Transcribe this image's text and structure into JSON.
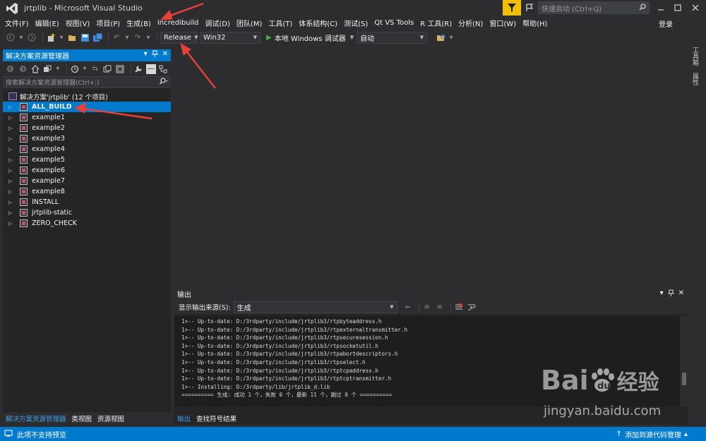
{
  "window": {
    "title": "jrtplib - Microsoft Visual Studio"
  },
  "quick_launch": {
    "placeholder": "快速启动 (Ctrl+Q)"
  },
  "menu": [
    "文件(F)",
    "编辑(E)",
    "视图(V)",
    "项目(P)",
    "生成(B)",
    "Incredibuild",
    "调试(D)",
    "团队(M)",
    "工具(T)",
    "体系结构(C)",
    "测试(S)",
    "Qt VS Tools",
    "R 工具(R)",
    "分析(N)",
    "窗口(W)",
    "帮助(H)"
  ],
  "login": "登录",
  "toolbar": {
    "config": "Release",
    "platform": "Win32",
    "run_label": "本地 Windows 调试器",
    "auto": "自动"
  },
  "side_tabs": [
    "工具箱",
    "属性"
  ],
  "solution_explorer": {
    "title": "解决方案资源管理器",
    "search_placeholder": "搜索解决方案资源管理器(Ctrl+;)",
    "solution_label": "解决方案'jrtplib' (12 个项目)",
    "projects": [
      "ALL_BUILD",
      "example1",
      "example2",
      "example3",
      "example4",
      "example5",
      "example6",
      "example7",
      "example8",
      "INSTALL",
      "jrtplib-static",
      "ZERO_CHECK"
    ],
    "selected": "ALL_BUILD",
    "bottom_tabs": [
      "解决方案资源管理器",
      "类视图",
      "资源视图"
    ]
  },
  "output": {
    "title": "输出",
    "source_label": "显示输出来源(S):",
    "source_value": "生成",
    "lines": [
      "1>-- Up-to-date: D:/3rdparty/include/jrtplib3/rtpbyteaddress.h",
      "1>-- Up-to-date: D:/3rdparty/include/jrtplib3/rtpexternaltransmitter.h",
      "1>-- Up-to-date: D:/3rdparty/include/jrtplib3/rtpsecuresession.h",
      "1>-- Up-to-date: D:/3rdparty/include/jrtplib3/rtpsocketutil.h",
      "1>-- Up-to-date: D:/3rdparty/include/jrtplib3/rtpabortdescriptors.h",
      "1>-- Up-to-date: D:/3rdparty/include/jrtplib3/rtpselect.h",
      "1>-- Up-to-date: D:/3rdparty/include/jrtplib3/rtptcpaddress.h",
      "1>-- Up-to-date: D:/3rdparty/include/jrtplib3/rtptcptransmitter.h",
      "1>-- Installing: D:/3rdparty/lib/jrtplib_d.lib",
      "========== 生成: 成功 1 个，失败 0 个，最新 11 个，跳过 0 个 =========="
    ],
    "bottom_tabs": [
      "输出",
      "查找符号结果"
    ]
  },
  "status": {
    "left": "此项不支持预览",
    "right": "添加到源代码管理"
  },
  "watermark": {
    "logo": "Bai",
    "logo_suffix": "du",
    "logo_cn": "经验",
    "url": "jingyan.baidu.com"
  },
  "colors": {
    "accent": "#007acc",
    "bg": "#2d2d30",
    "annotation": "#e8403a"
  }
}
